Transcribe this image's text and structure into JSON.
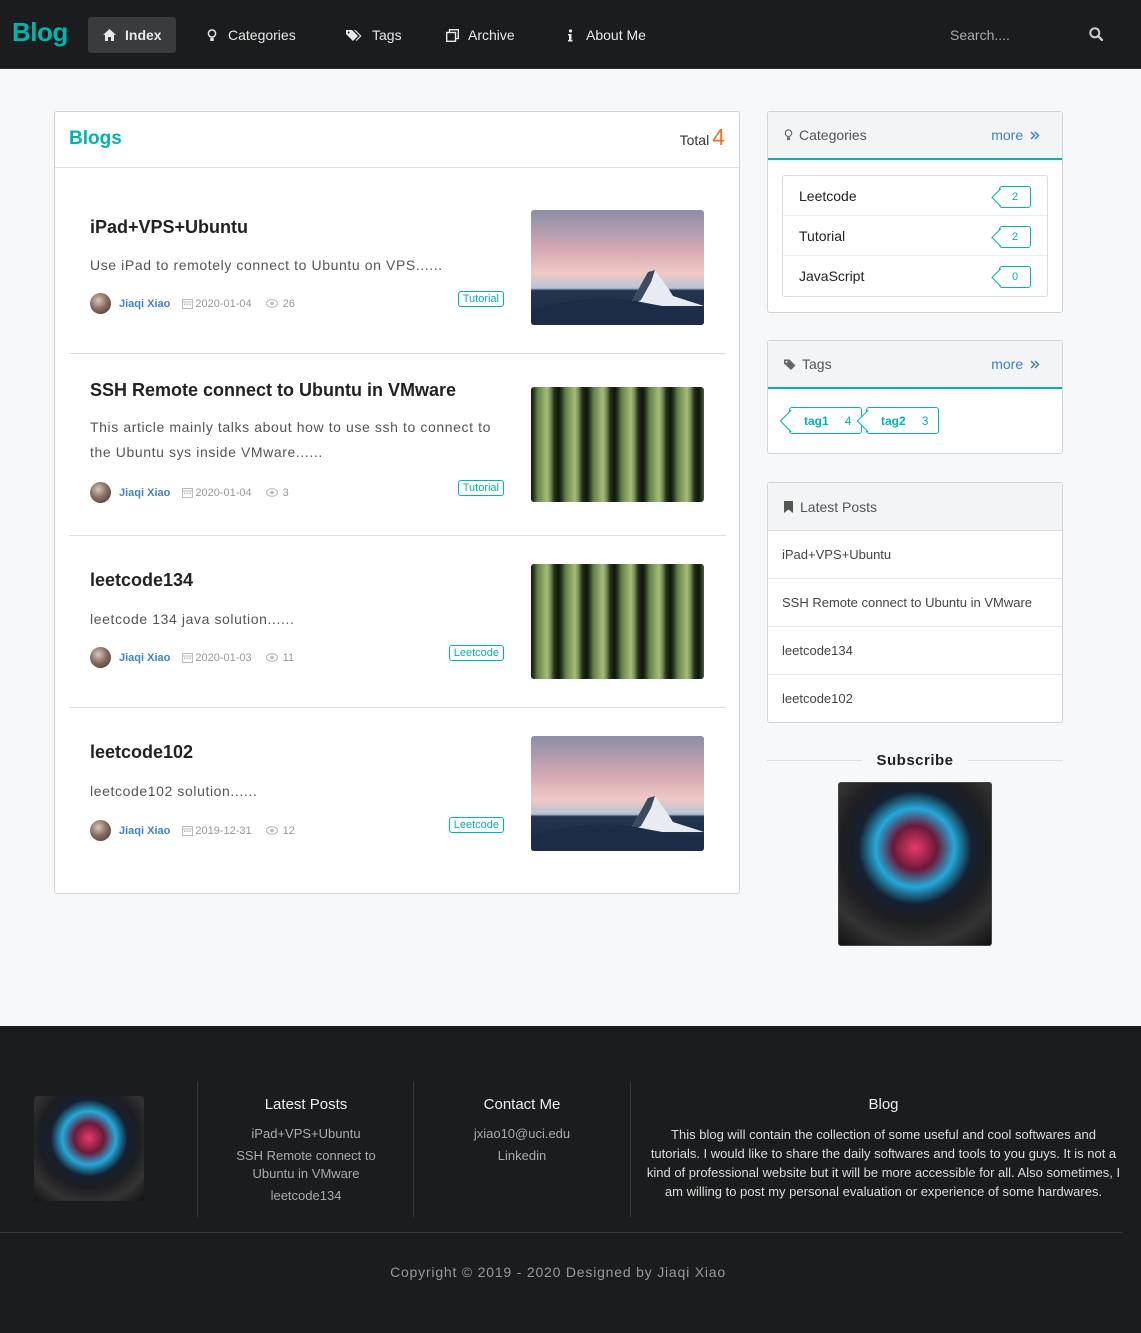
{
  "nav": {
    "brand": "Blog",
    "items": [
      {
        "label": "Index",
        "icon": "home-icon"
      },
      {
        "label": "Categories",
        "icon": "lightbulb-icon"
      },
      {
        "label": "Tags",
        "icon": "tags-icon"
      },
      {
        "label": "Archive",
        "icon": "clone-icon"
      },
      {
        "label": "About Me",
        "icon": "info-icon"
      }
    ],
    "search_placeholder": "Search....",
    "search_icon": "search-icon"
  },
  "blogs": {
    "heading": "Blogs",
    "total_label": "Total",
    "total_count": "4",
    "posts": [
      {
        "title": "iPad+VPS+Ubuntu",
        "desc": "Use iPad to remotely connect to Ubuntu on VPS......",
        "author": "Jiaqi Xiao",
        "date": "2020-01-04",
        "views": "26",
        "tag": "Tutorial",
        "thumb": "mountain"
      },
      {
        "title": "SSH Remote connect to Ubuntu in VMware",
        "desc": "This article mainly talks about how to use ssh to connect to the Ubuntu sys inside VMware......",
        "author": "Jiaqi Xiao",
        "date": "2020-01-04",
        "views": "3",
        "tag": "Tutorial",
        "thumb": "bamboo"
      },
      {
        "title": "leetcode134",
        "desc": "leetcode 134 java solution......",
        "author": "Jiaqi Xiao",
        "date": "2020-01-03",
        "views": "11",
        "tag": "Leetcode",
        "thumb": "bamboo"
      },
      {
        "title": "leetcode102",
        "desc": "leetcode102 solution......",
        "author": "Jiaqi Xiao",
        "date": "2019-12-31",
        "views": "12",
        "tag": "Leetcode",
        "thumb": "mountain"
      }
    ]
  },
  "sidebar": {
    "categories": {
      "title": "Categories",
      "more": "more",
      "items": [
        {
          "name": "Leetcode",
          "count": "2"
        },
        {
          "name": "Tutorial",
          "count": "2"
        },
        {
          "name": "JavaScript",
          "count": "0"
        }
      ]
    },
    "tags": {
      "title": "Tags",
      "more": "more",
      "items": [
        {
          "name": "tag1",
          "count": "4"
        },
        {
          "name": "tag2",
          "count": "3"
        }
      ]
    },
    "latest": {
      "title": "Latest Posts",
      "items": [
        "iPad+VPS+Ubuntu",
        "SSH Remote connect to Ubuntu in VMware",
        "leetcode134",
        "leetcode102"
      ]
    },
    "subscribe": "Subscribe"
  },
  "footer": {
    "latest_title": "Latest Posts",
    "latest_links": [
      "iPad+VPS+Ubuntu",
      "SSH Remote connect to Ubuntu in VMware",
      "leetcode134"
    ],
    "contact_title": "Contact Me",
    "contact_links": [
      "jxiao10@uci.edu",
      "Linkedin"
    ],
    "blog_title": "Blog",
    "blog_text": "This blog will contain the collection of some useful and cool softwares and tutorials. I would like to share the daily softwares and tools to you guys. It is not a kind of professional website but it will be more accessible for all. Also sometimes, I am willing to post my personal evaluation or experience of some hardwares.",
    "copyright": "Copyright © 2019 - 2020 Designed by Jiaqi Xiao"
  },
  "colors": {
    "accent": "#00b5ad",
    "total_count": "#f2711c",
    "author_link": "#4183c4",
    "nav_bg": "#1b1c1d"
  }
}
